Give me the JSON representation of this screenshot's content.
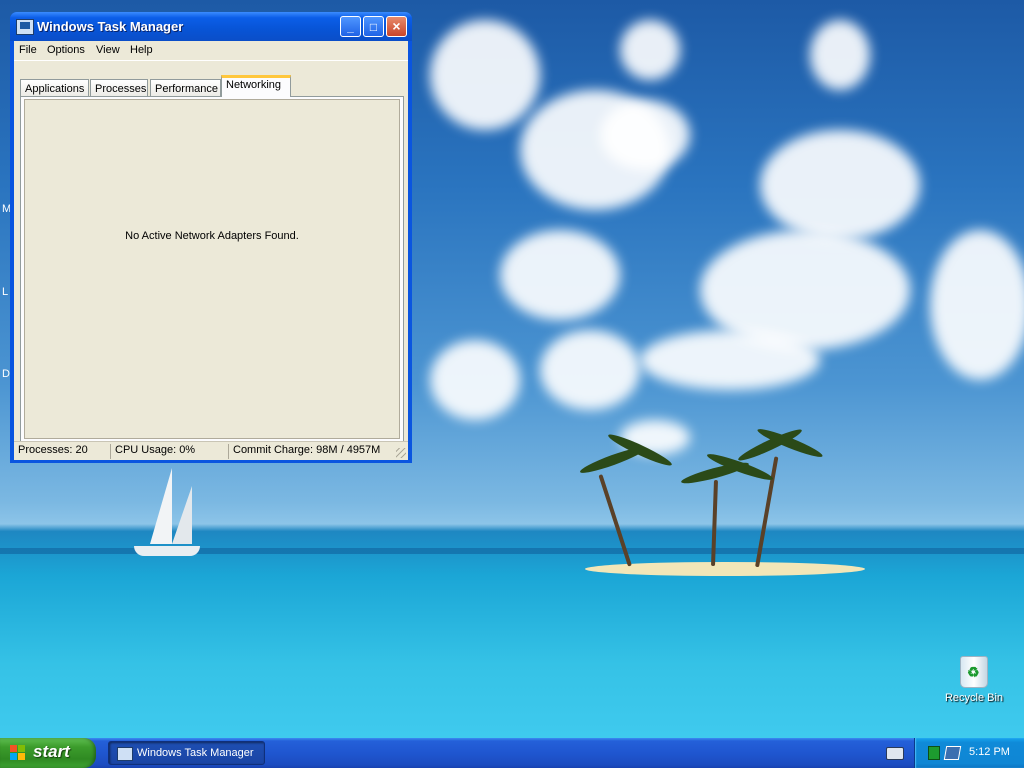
{
  "window": {
    "title": "Windows Task Manager",
    "menu": [
      "File",
      "Options",
      "View",
      "Help"
    ],
    "tabs": [
      {
        "label": "Applications",
        "active": false
      },
      {
        "label": "Processes",
        "active": false
      },
      {
        "label": "Performance",
        "active": false
      },
      {
        "label": "Networking",
        "active": true
      }
    ],
    "networking_message": "No Active Network Adapters Found.",
    "status": {
      "processes": "Processes: 20",
      "cpu": "CPU Usage: 0%",
      "commit": "Commit Charge: 98M / 4957M"
    },
    "caption_buttons": [
      "minimize-icon",
      "maximize-icon",
      "close-icon"
    ]
  },
  "desktop": {
    "edge_letters": [
      "M",
      "L",
      "D"
    ],
    "icons": [
      {
        "label": "Recycle Bin",
        "icon": "recycle-bin-icon"
      }
    ]
  },
  "taskbar": {
    "start_label": "start",
    "tasks": [
      {
        "label": "Windows Task Manager",
        "icon": "task-manager-icon"
      }
    ],
    "clock": "5:12 PM"
  },
  "colors": {
    "title_bar": "#0854d6",
    "window_face": "#ece9d8",
    "taskbar": "#2460d9",
    "start_button": "#3c9c2c",
    "tray": "#0f8ad8",
    "active_tab_highlight": "#ffc73c"
  }
}
